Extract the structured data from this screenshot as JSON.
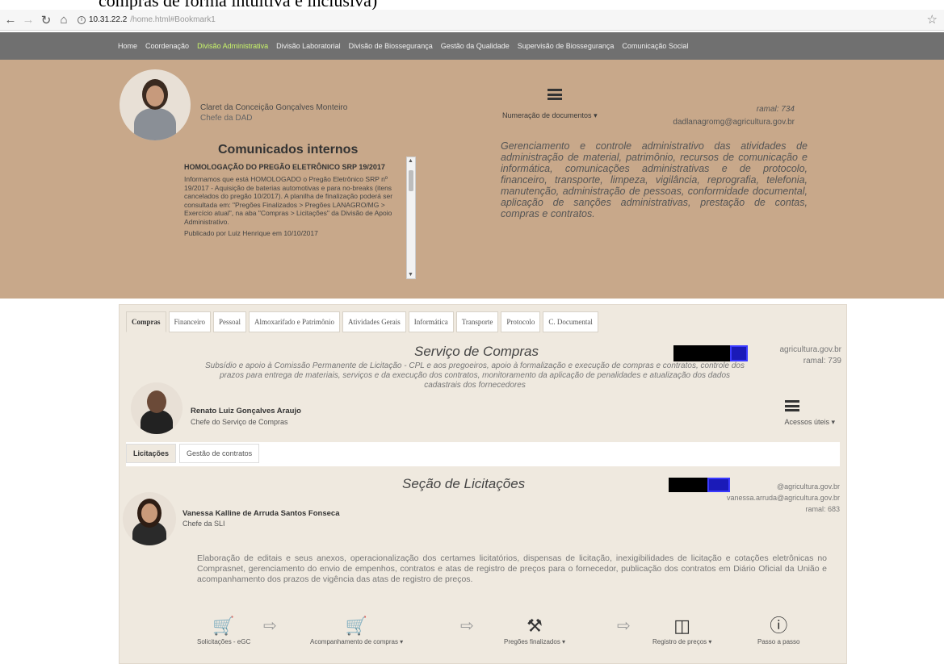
{
  "cropped_header": "compras de forma intuitiva e inclusiva)",
  "browser": {
    "url_host": "10.31.22.2",
    "url_path": "/home.html#Bookmark1"
  },
  "topnav": {
    "items": [
      "Home",
      "Coordenação",
      "Divisão Administrativa",
      "Divisão Laboratorial",
      "Divisão de Biossegurança",
      "Gestão da Qualidade",
      "Supervisão de Biossegurança",
      "Comunicação Social"
    ]
  },
  "hero": {
    "chief_name": "Claret da Conceição Gonçalves Monteiro",
    "chief_role": "Chefe da DAD",
    "comm_title": "Comunicados internos",
    "comm_headline": "HOMOLOGAÇÃO DO PREGÃO ELETRÔNICO SRP 19/2017",
    "comm_body": "Informamos que está HOMOLOGADO o Pregão Eletrônico SRP nº 19/2017 - Aquisição de baterias automotivas e para no-breaks (itens cancelados do pregão 10/2017). A planilha de finalização poderá ser consultada em: \"Pregões Finalizados > Pregões LANAGRO/MG > Exercício atual\", na aba \"Compras > Licitações\" da Divisão de Apoio Administrativo.",
    "comm_pub": "Publicado por Luiz Henrique em 10/10/2017",
    "numeracao": "Numeração de documentos ▾",
    "ramal": "ramal: 734",
    "email": "dadlanagromg@agricultura.gov.br",
    "description": "Gerenciamento e controle administrativo das atividades de administração de material, patrimônio, recursos de comunicação e informática, comunicações administrativas e de protocolo, financeiro, transporte, limpeza, vigilância, reprografia, telefonia, manutenção, administração de pessoas, conformidade documental, aplicação de sanções administrativas, prestação de contas, compras e contratos."
  },
  "tabs": [
    "Compras",
    "Financeiro",
    "Pessoal",
    "Almoxarifado e Patrimônio",
    "Atividades Gerais",
    "Informática",
    "Transporte",
    "Protocolo",
    "C. Documental"
  ],
  "service": {
    "title": "Serviço de Compras",
    "description": "Subsídio e apoio à Comissão Permanente de Licitação - CPL e aos pregoeiros, apoio à formalização e execução de compras e contratos, controle dos prazos para entrega de materiais, serviços e da execução dos contratos, monitoramento da aplicação de penalidades e atualização dos dados cadastrais dos fornecedores",
    "email": "agricultura.gov.br",
    "ramal": "ramal: 739",
    "chief_name": "Renato Luiz Gonçalves Araujo",
    "chief_role": "Chefe do Serviço de Compras",
    "acessos": "Acessos úteis ▾"
  },
  "subtabs": [
    "Licitações",
    "Gestão de contratos"
  ],
  "section": {
    "title": "Seção de Licitações",
    "email1": "@agricultura.gov.br",
    "email2": "vanessa.arruda@agricultura.gov.br",
    "ramal": "ramal: 683",
    "chief_name": "Vanessa Kalline de Arruda Santos Fonseca",
    "chief_role": "Chefe da SLI",
    "description": "Elaboração de editais e seus anexos, operacionalização dos certames licitatórios, dispensas de licitação, inexigibilidades de licitação e cotações eletrônicas no Comprasnet, gerenciamento do envio de empenhos, contratos e atas de registro de preços para o fornecedor, publicação dos contratos em Diário Oficial da União e acompanhamento dos prazos de vigência das atas de registro de preços."
  },
  "flow": [
    {
      "label": "Solicitações - eGC",
      "icon": "cart-icon"
    },
    {
      "label": "Acompanhamento de compras ▾",
      "icon": "cart-check-icon"
    },
    {
      "label": "Pregões finalizados ▾",
      "icon": "gavel-icon"
    },
    {
      "label": "Registro de preços ▾",
      "icon": "basket-icon"
    },
    {
      "label": "Passo a passo",
      "icon": "question-icon"
    }
  ]
}
